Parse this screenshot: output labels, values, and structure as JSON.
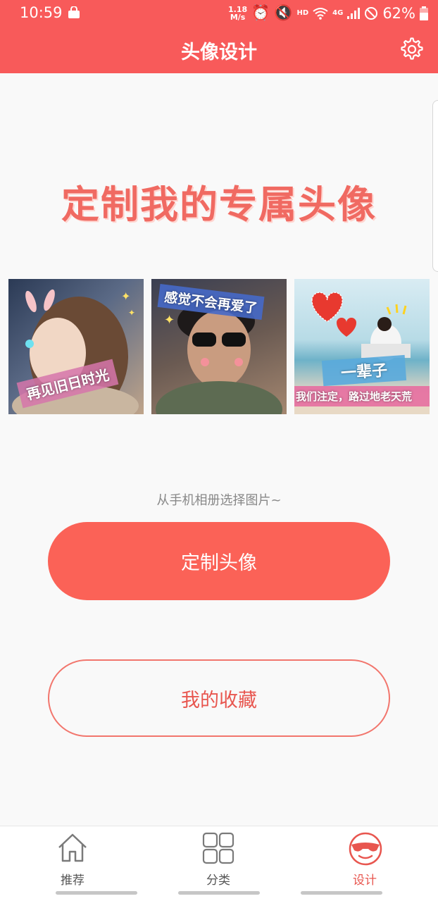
{
  "status": {
    "time": "10:59",
    "speed_top": "1.18",
    "speed_bottom": "M/s",
    "hd": "HD",
    "network": "4G",
    "battery": "62%"
  },
  "header": {
    "title": "头像设计"
  },
  "banner": {
    "title": "定制我的专属头像"
  },
  "samples": [
    {
      "caption": "再见旧日时光"
    },
    {
      "caption": "感觉不会再爱了"
    },
    {
      "caption": "一辈子",
      "subcaption": "我们注定，路过地老天荒"
    }
  ],
  "hint": "从手机相册选择图片~",
  "buttons": {
    "custom": "定制头像",
    "favorites": "我的收藏"
  },
  "tabs": [
    {
      "label": "推荐"
    },
    {
      "label": "分类"
    },
    {
      "label": "设计"
    }
  ],
  "colors": {
    "accent": "#f85a5a",
    "button": "#fb6257",
    "active_tab": "#e8564f"
  }
}
